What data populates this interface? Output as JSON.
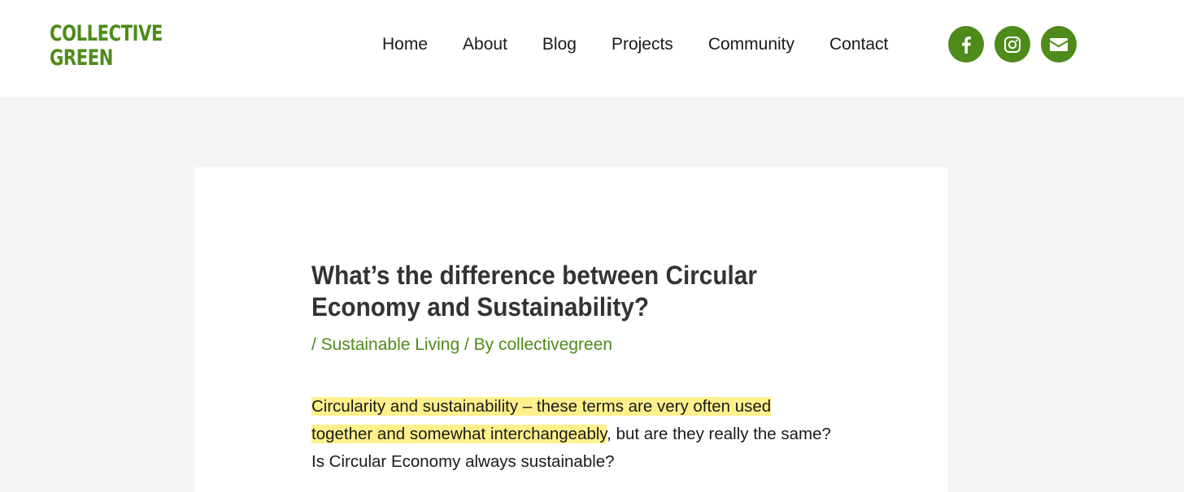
{
  "brand": {
    "line1": "COLLECTIVE",
    "line2": "GREEN"
  },
  "nav": [
    {
      "label": "Home"
    },
    {
      "label": "About"
    },
    {
      "label": "Blog"
    },
    {
      "label": "Projects"
    },
    {
      "label": "Community"
    },
    {
      "label": "Contact"
    }
  ],
  "social": [
    {
      "icon": "facebook-icon"
    },
    {
      "icon": "instagram-icon"
    },
    {
      "icon": "email-icon"
    }
  ],
  "colors": {
    "brand_green": "#4e8b1a",
    "highlight": "#fff08c",
    "page_bg": "#f4f4f4"
  },
  "post": {
    "title": "What’s the difference between Circular Economy and Sustainability?",
    "meta_sep1": "/ ",
    "category": "Sustainable Living",
    "meta_sep2": " / By ",
    "author": "collectivegreen",
    "excerpt_highlighted": "Circularity and sustainability – these terms are very often used together and somewhat interchangeably",
    "excerpt_rest": ", but are they really the same? Is Circular Economy always sustainable?"
  }
}
